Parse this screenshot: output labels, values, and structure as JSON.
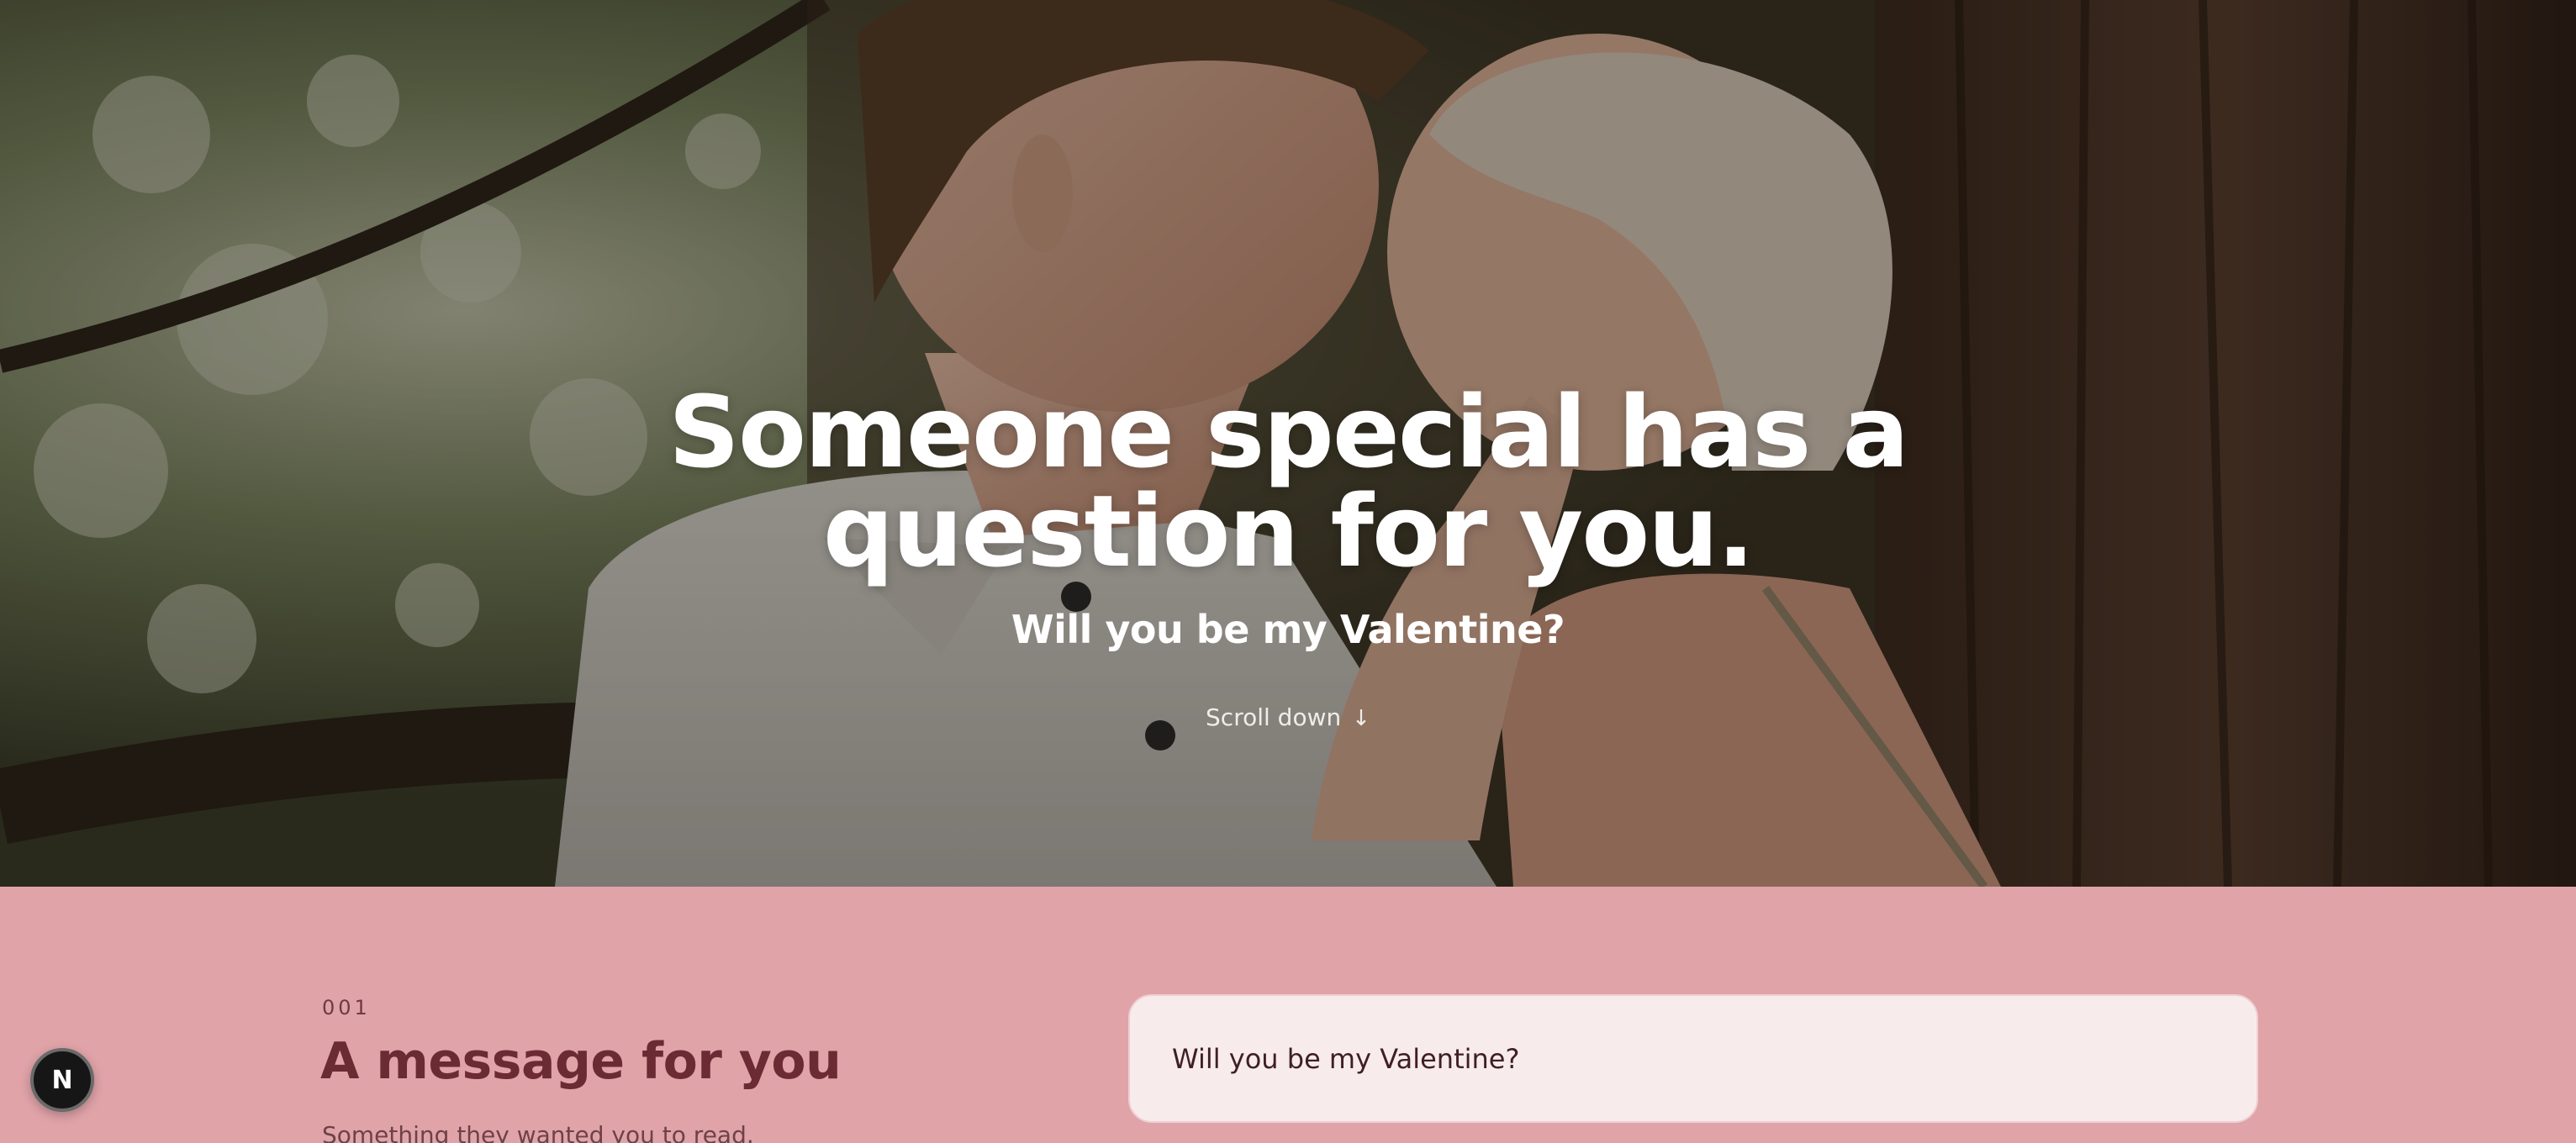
{
  "hero": {
    "title": "Someone special has a question for you.",
    "subtitle": "Will you be my Valentine?",
    "scroll_label": "Scroll down",
    "scroll_icon": "arrow-down-icon",
    "overlay_color": "#0c0806"
  },
  "section": {
    "number": "001",
    "title": "A message for you",
    "description": "Something they wanted you to read.",
    "background_color": "#e0a3a8"
  },
  "message_card": {
    "text": "Will you be my Valentine?"
  },
  "badge": {
    "letter": "N",
    "icon": "nextjs-logo-icon"
  }
}
